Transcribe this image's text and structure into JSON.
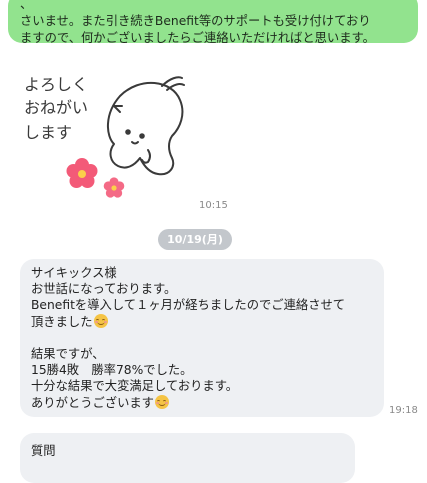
{
  "messages": {
    "outgoing_top": {
      "lines": [
        "、 　　　　　　　　　　　　　　　　　　　",
        "さいませ。また引き続きBenefit等のサポートも受け付けており",
        "ますので、何かございましたらご連絡いただければと思います。"
      ]
    },
    "sticker": {
      "text_lines": [
        "よろしく",
        "おねがい",
        "します"
      ],
      "time": "10:15"
    },
    "date_divider": "10/19(月)",
    "incoming_1": {
      "lines": [
        "サイキックス様",
        "お世話になっております。",
        "Benefitを導入して１ヶ月が経ちましたのでご連絡させて",
        "頂きました",
        "",
        "結果ですが、",
        "15勝4敗　勝率78%でした。",
        "十分な結果で大変満足しております。",
        "ありがとうございます"
      ],
      "time": "19:18"
    },
    "incoming_2": {
      "text": "質問"
    }
  },
  "colors": {
    "outgoing_bubble": "#92e38e",
    "incoming_bubble": "#eef0f3",
    "date_pill": "#c3c7cc"
  },
  "icons": {
    "emoji": "smiling-face-with-smiling-eyes-icon",
    "sticker": "cat-bowing-sticker-with-flowers"
  }
}
